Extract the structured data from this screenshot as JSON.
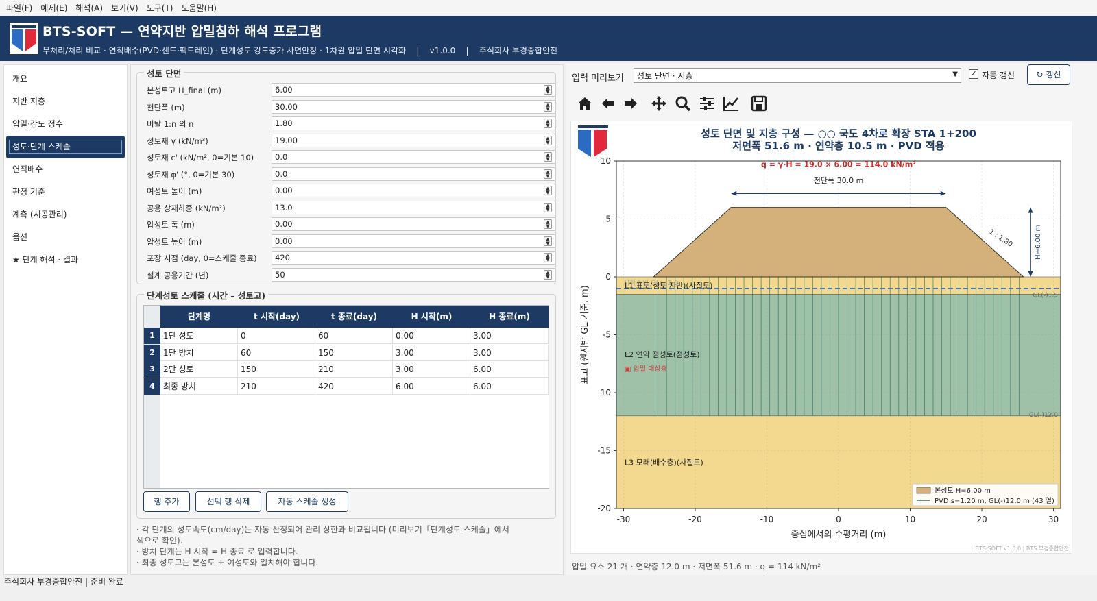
{
  "menu": [
    "파일(F)",
    "예제(E)",
    "해석(A)",
    "보기(V)",
    "도구(T)",
    "도움말(H)"
  ],
  "header": {
    "title": "BTS-SOFT — 연약지반 압밀침하 해석 프로그램",
    "subtitle": "무처리/처리 비교 · 연직배수(PVD·샌드·팩드레인) · 단계성토 강도증가 사면안정 · 1차원 압밀 단면 시각화    |    v1.0.0    |    주식회사 부경종합안전"
  },
  "sidebar": {
    "items": [
      "개요",
      "지반 지층",
      "압밀·강도 정수",
      "성토·단계 스케줄",
      "연직배수",
      "판정 기준",
      "계측 (시공관리)",
      "옵션",
      "★ 단계 해석 · 결과"
    ],
    "active_index": 3
  },
  "embankment": {
    "group_title": "성토 단면",
    "fields": [
      {
        "label": "본성토고 H_final (m)",
        "value": "6.00"
      },
      {
        "label": "천단폭 (m)",
        "value": "30.00"
      },
      {
        "label": "비탈 1:n 의 n",
        "value": "1.80"
      },
      {
        "label": "성토재 γ (kN/m³)",
        "value": "19.00"
      },
      {
        "label": "성토재 c' (kN/m², 0=기본 10)",
        "value": "0.0"
      },
      {
        "label": "성토재 φ' (°, 0=기본 30)",
        "value": "0.0"
      },
      {
        "label": "여성토 높이 (m)",
        "value": "0.00"
      },
      {
        "label": "공용 상재하중 (kN/m²)",
        "value": "13.0"
      },
      {
        "label": "압성토 폭 (m)",
        "value": "0.00"
      },
      {
        "label": "압성토 높이 (m)",
        "value": "0.00"
      },
      {
        "label": "포장 시점 (day, 0=스케줄 종료)",
        "value": "420"
      },
      {
        "label": "설계 공용기간 (년)",
        "value": "50"
      }
    ]
  },
  "schedule": {
    "group_title": "단계성토 스케줄 (시간 – 성토고)",
    "columns": [
      "단계명",
      "t 시작(day)",
      "t 종료(day)",
      "H 시작(m)",
      "H 종료(m)"
    ],
    "rows": [
      {
        "n": "1",
        "cells": [
          "1단 성토",
          "0",
          "60",
          "0.00",
          "3.00"
        ]
      },
      {
        "n": "2",
        "cells": [
          "1단 방치",
          "60",
          "150",
          "3.00",
          "3.00"
        ]
      },
      {
        "n": "3",
        "cells": [
          "2단 성토",
          "150",
          "210",
          "3.00",
          "6.00"
        ]
      },
      {
        "n": "4",
        "cells": [
          "최종 방치",
          "210",
          "420",
          "6.00",
          "6.00"
        ]
      }
    ],
    "buttons": {
      "add": "행 추가",
      "delete": "선택 행 삭제",
      "auto": "자동 스케줄 생성"
    }
  },
  "notes": [
    "· 각 단계의 성토속도(cm/day)는 자동 산정되어 관리 상한과 비교됩니다 (미리보기「단계성토 스케줄」에서",
    "색으로 확인).",
    "· 방치 단계는 H 시작 = H 종료 로 입력합니다.",
    "· 최종 성토고는 본성토 + 여성토와 일치해야 합니다."
  ],
  "preview": {
    "label": "입력 미리보기",
    "select_value": "성토 단면 · 지층",
    "auto_refresh_label": "자동 갱신",
    "auto_refresh_checked": true,
    "refresh_button": "↻ 갱신",
    "toolbar_icons": [
      "home-icon",
      "back-arrow-icon",
      "forward-arrow-icon",
      "pan-icon",
      "zoom-icon",
      "configure-subplots-icon",
      "edit-axis-icon",
      "save-icon"
    ],
    "footer": "압밀 요소 21 개 · 연약층 12.0 m · 저면폭 51.6 m · q = 114 kN/m²"
  },
  "chart_data": {
    "type": "cross-section",
    "title": "성토 단면 및 지층 구성 — ○○ 국도 4차로 확장 STA 1+200",
    "subtitle": "저면폭 51.6 m · 연약층 10.5 m · PVD 적용",
    "xlabel": "중심에서의 수평거리 (m)",
    "ylabel": "표고 (원지반 GL 기준, m)",
    "xlim": [
      -31,
      31
    ],
    "ylim": [
      -20,
      10
    ],
    "xticks": [
      -30,
      -20,
      -10,
      0,
      10,
      20,
      30
    ],
    "yticks": [
      10,
      5,
      0,
      -5,
      -10,
      -15,
      -20
    ],
    "embankment_polygon": [
      [
        -25.8,
        0
      ],
      [
        -15,
        6
      ],
      [
        15,
        6
      ],
      [
        25.8,
        0
      ]
    ],
    "layers": [
      {
        "name": "L1 표토(성토 지반)(사질토)",
        "top": 0,
        "bottom": -1.5,
        "color": "#f2d98f"
      },
      {
        "name": "L2 연약 점성토(점성토)",
        "top": -1.5,
        "bottom": -12,
        "color": "#9ec1a8"
      },
      {
        "name": "L3 모래(배수층)(사질토)",
        "top": -12,
        "bottom": -20,
        "color": "#f2d98f"
      }
    ],
    "layer_boundary_labels": [
      "GL(-)1.5",
      "GL(-)12.0"
    ],
    "water_table": -1.0,
    "water_table_label": "지하수위 GL(-)1.0",
    "consolidation_label": "▣ 압밀 대상층",
    "pvd": {
      "spacing": 1.2,
      "count": 43,
      "x_from": -25.2,
      "x_to": 25.2,
      "bottom": -12
    },
    "annotations": {
      "load": "q = γ·H = 19.0 × 6.00 = 114.0 kN/m²",
      "crest": "천단폭 30.0 m",
      "height": "H=6.00 m",
      "slope": "1 : 1.80"
    },
    "legend": [
      "본성토 H=6.00 m",
      "PVD s=1.20 m, GL(-)12.0 m (43 열)"
    ],
    "legend_position": "bottom-right",
    "watermark": "BTS-SOFT v1.0.0  |  BTS 부경종합안전",
    "colors": {
      "embankment": "#d4b07a",
      "pvd": "#2e6b5a",
      "water": "#3a78c4",
      "load_text": "#cc2b2b",
      "title": "#1c3a63"
    }
  },
  "status": {
    "left": "주식회사 부경종합안전",
    "right": "준비 완료"
  }
}
